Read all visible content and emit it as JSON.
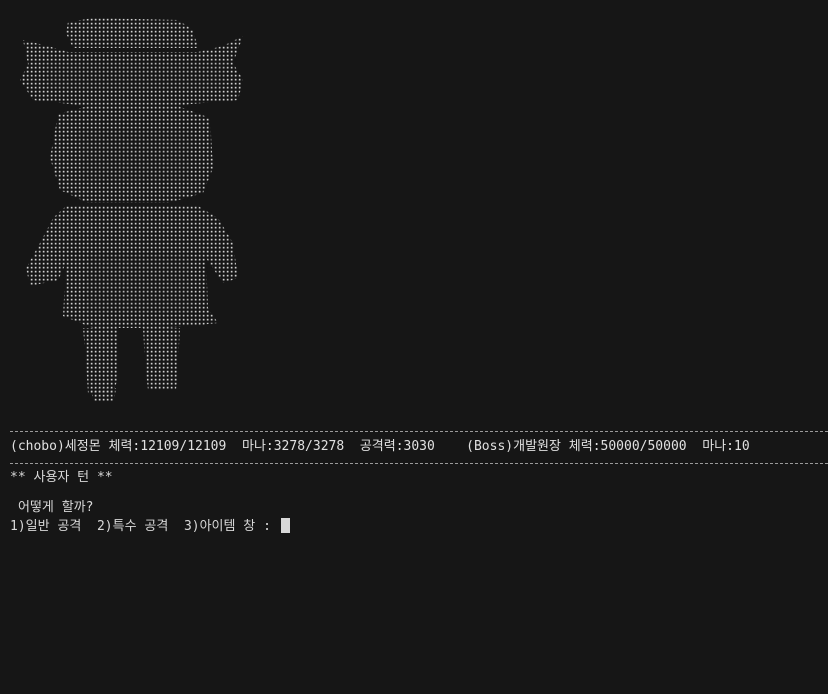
{
  "terminal": {
    "status_line": "(chobo)세정몬 체력:12109/12109  마나:3278/3278  공격력:3030    (Boss)개발원장 체력:50000/50000  마나:10",
    "turn_text": "** 사용자 턴 **",
    "question": "어떻게 할까?",
    "menu_prompt": "1)일반 공격  2)특수 공격  3)아이템 창 : ",
    "ascii_art_subject": "character-figure",
    "colors": {
      "background": "#161616",
      "text": "#d8d8d8",
      "art": "#cfcfcf"
    }
  }
}
